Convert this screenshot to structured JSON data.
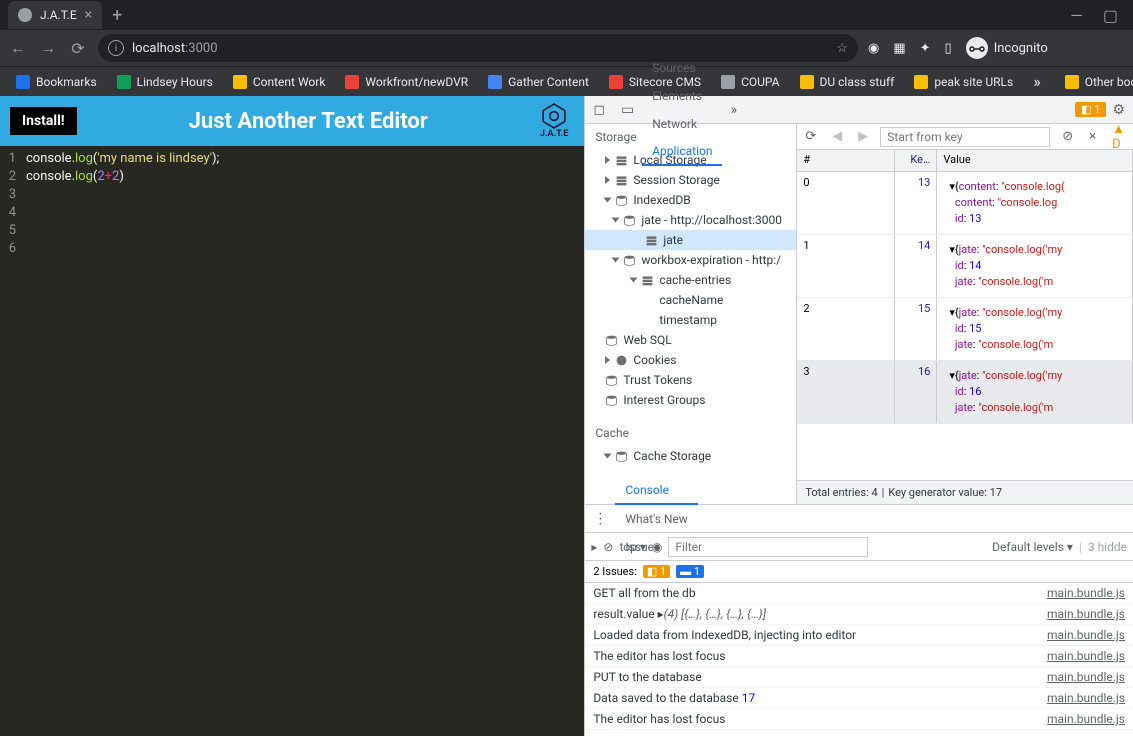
{
  "browser": {
    "tab_title": "J.A.T.E",
    "url_host": "localhost",
    "url_port": ":3000",
    "incognito_label": "Incognito"
  },
  "bookmarks": [
    {
      "label": "Bookmarks",
      "color": "#1a73e8"
    },
    {
      "label": "Lindsey Hours",
      "color": "#0f9d58"
    },
    {
      "label": "Content Work",
      "color": "#fbbc04"
    },
    {
      "label": "Workfront/newDVR",
      "color": "#ea4335"
    },
    {
      "label": "Gather Content",
      "color": "#4285f4"
    },
    {
      "label": "Sitecore CMS",
      "color": "#ea4335"
    },
    {
      "label": "COUPA",
      "color": "#9aa0a6"
    },
    {
      "label": "DU class stuff",
      "color": "#fbbc04"
    },
    {
      "label": "peak site URLs",
      "color": "#fbbc04"
    }
  ],
  "bookmarks_overflow": "Other book",
  "jate": {
    "install": "Install!",
    "title": "Just Another Text Editor",
    "logo_text": "J.A.T.E",
    "code_lines": [
      {
        "n": "1",
        "html": "console.<span class='fn'>log</span>(<span class='str'>'my name is lindsey'</span>);"
      },
      {
        "n": "2",
        "html": "console.<span class='fn'>log</span>(<span class='num'>2</span><span class='op'>+</span><span class='num'>2</span>)"
      },
      {
        "n": "3",
        "html": ""
      },
      {
        "n": "4",
        "html": ""
      },
      {
        "n": "5",
        "html": ""
      },
      {
        "n": "6",
        "html": ""
      }
    ]
  },
  "devtools": {
    "tabs": [
      "Sources",
      "Elements",
      "Network",
      "Application"
    ],
    "active_tab": "Application",
    "issue_count": "1",
    "storage_header": "Storage",
    "cache_header": "Cache",
    "storage_tree": {
      "local": "Local Storage",
      "session": "Session Storage",
      "indexeddb": "IndexedDB",
      "jate_db": "jate - http://localhost:3000",
      "jate_store": "jate",
      "workbox": "workbox-expiration - http:/",
      "cache_entries": "cache-entries",
      "cacheName": "cacheName",
      "timestamp": "timestamp",
      "websql": "Web SQL",
      "cookies": "Cookies",
      "trust": "Trust Tokens",
      "interest": "Interest Groups",
      "cache_storage": "Cache Storage"
    },
    "data_toolbar": {
      "start_placeholder": "Start from key"
    },
    "columns": {
      "idx": "#",
      "key": "Ke…",
      "val": "Value"
    },
    "rows": [
      {
        "idx": "0",
        "key": "13",
        "lines": [
          "▾{<span class='jkey'>content</span>: <span class='jstr'>\"console.log(</span>",
          "&nbsp;&nbsp;<span class='jkey'>content</span>: <span class='jstr'>\"console.log</span>",
          "&nbsp;&nbsp;<span class='jkey'>id</span>: <span class='jnum'>13</span>"
        ]
      },
      {
        "idx": "1",
        "key": "14",
        "lines": [
          "▾{<span class='jkey'>jate</span>: <span class='jstr'>\"console.log('my</span>",
          "&nbsp;&nbsp;<span class='jkey'>id</span>: <span class='jnum'>14</span>",
          "&nbsp;&nbsp;<span class='jkey'>jate</span>: <span class='jstr'>\"console.log('m</span>"
        ]
      },
      {
        "idx": "2",
        "key": "15",
        "lines": [
          "▾{<span class='jkey'>jate</span>: <span class='jstr'>\"console.log('my</span>",
          "&nbsp;&nbsp;<span class='jkey'>id</span>: <span class='jnum'>15</span>",
          "&nbsp;&nbsp;<span class='jkey'>jate</span>: <span class='jstr'>\"console.log('m</span>"
        ]
      },
      {
        "idx": "3",
        "key": "16",
        "sel": true,
        "lines": [
          "▾{<span class='jkey'>jate</span>: <span class='jstr'>\"console.log('my</span>",
          "&nbsp;&nbsp;<span class='jkey'>id</span>: <span class='jnum'>16</span>",
          "&nbsp;&nbsp;<span class='jkey'>jate</span>: <span class='jstr'>\"console.log('m</span>"
        ]
      }
    ],
    "footer_entries": "Total entries: 4",
    "footer_keygen": "Key generator value: 17"
  },
  "console": {
    "tabs": [
      "Console",
      "What's New",
      "Issues"
    ],
    "active": "Console",
    "top_label": "top ▾",
    "filter_placeholder": "Filter",
    "levels": "Default levels ▾",
    "hidden": "3 hidde",
    "issues_label": "2 Issues:",
    "issue_badge1": "1",
    "issue_badge2": "1",
    "logs": [
      {
        "msg": "GET all from the db",
        "src": "main.bundle.js"
      },
      {
        "msg": "result.value ▸<span class='log-obj'>(4) [{…}, {…}, {…}, {…}]</span>",
        "src": "main.bundle.js"
      },
      {
        "msg": "Loaded data from IndexedDB, injecting into editor",
        "src": "main.bundle.js"
      },
      {
        "msg": "The editor has lost focus",
        "src": "main.bundle.js"
      },
      {
        "msg": "PUT to the database",
        "src": "main.bundle.js"
      },
      {
        "msg": "Data saved to the database <span class='jnum'>17</span>",
        "src": "main.bundle.js"
      },
      {
        "msg": "The editor has lost focus",
        "src": "main.bundle.js"
      }
    ]
  }
}
